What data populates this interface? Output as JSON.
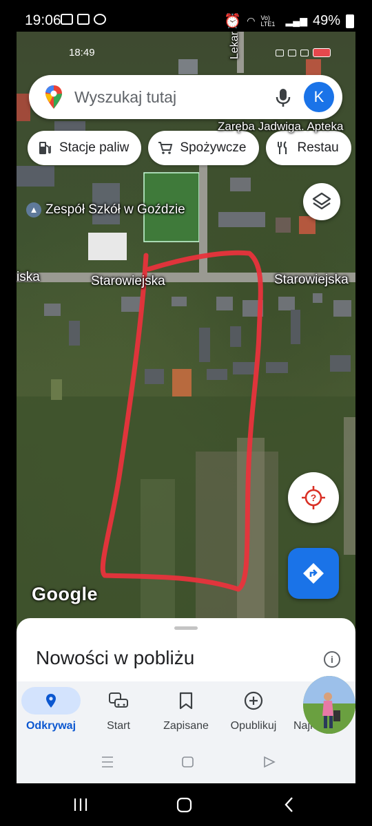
{
  "status_bar": {
    "time": "19:06",
    "battery": "49%",
    "net": "Vo) LTE1"
  },
  "inner_status": {
    "time": "18:49"
  },
  "search": {
    "placeholder": "Wyszukaj tutaj",
    "avatar_letter": "K"
  },
  "chips": [
    {
      "label": "Stacje paliw",
      "icon": "gas-station-icon"
    },
    {
      "label": "Spożywcze",
      "icon": "cart-icon"
    },
    {
      "label": "Restau",
      "icon": "restaurant-icon"
    }
  ],
  "map_labels": {
    "pharmacy": "Zaręba Jadwiga. Apteka",
    "lekarska": "Lekarska",
    "school": "Zespół Szkół w Goździe",
    "street_left": "Starowiejska",
    "street_right": "Starowiejska",
    "street_edge": "iska",
    "google": "Google"
  },
  "sheet": {
    "title": "Nowości w pobliżu"
  },
  "nav": [
    {
      "label": "Odkrywaj",
      "icon": "location-pin-icon",
      "active": true
    },
    {
      "label": "Start",
      "icon": "commute-icon",
      "active": false
    },
    {
      "label": "Zapisane",
      "icon": "bookmark-icon",
      "active": false
    },
    {
      "label": "Opublikuj",
      "icon": "add-circle-icon",
      "active": false
    },
    {
      "label": "Najn",
      "icon": "avatar",
      "active": false
    }
  ],
  "colors": {
    "accent": "#1a73e8",
    "annotation": "#e8333c",
    "nav_active": "#0b57d0"
  }
}
